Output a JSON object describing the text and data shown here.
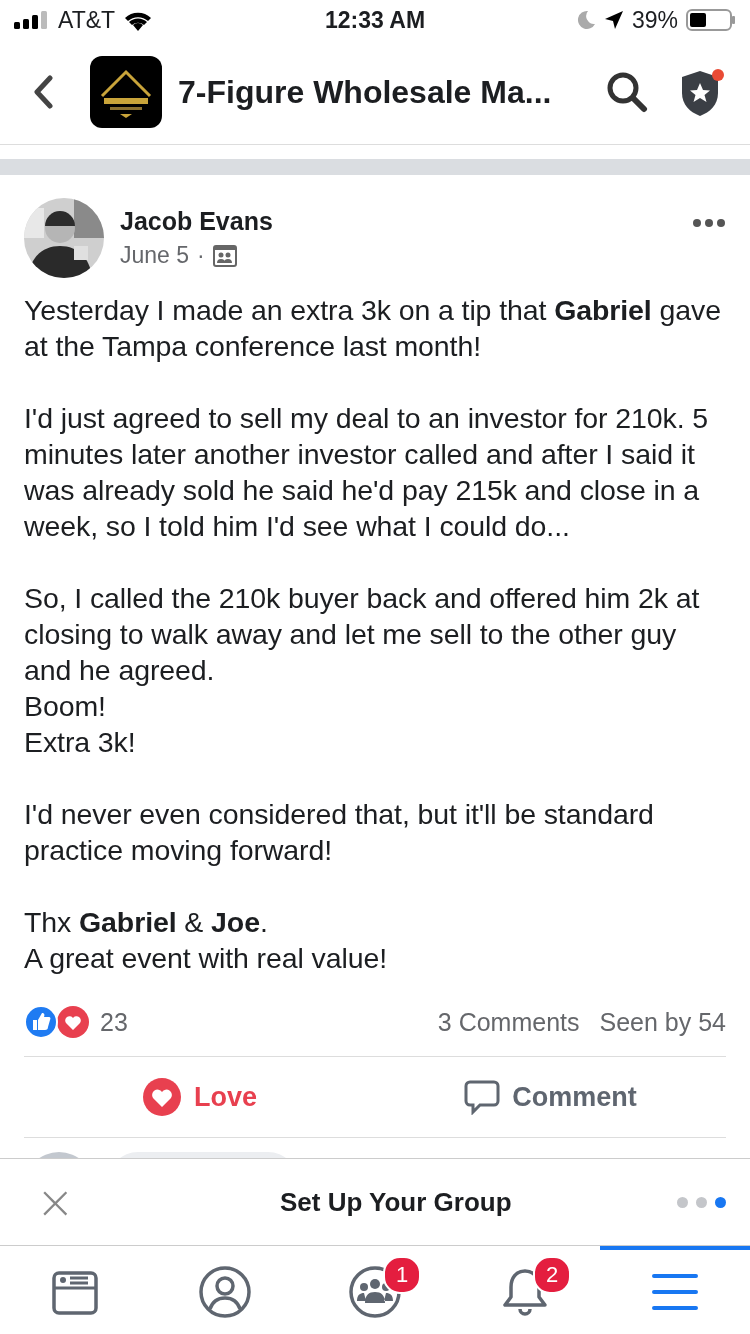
{
  "status_bar": {
    "carrier": "AT&T",
    "time": "12:33 AM",
    "battery": "39%"
  },
  "header": {
    "title": "7-Figure Wholesale Ma...",
    "notification_dot": true
  },
  "post": {
    "author": "Jacob Evans",
    "date": "June 5",
    "separator": "·",
    "paragraphs": [
      [
        "Yesterday I made an extra 3k on a tip that **Gabriel** gave at the Tampa conference last month!"
      ],
      [
        "I'd just agreed to sell my deal to an investor for 210k. 5 minutes later another investor called and after I said it was already sold he said he'd pay 215k and close in a week, so I told him I'd see what I could do..."
      ],
      [
        "So, I called the 210k buyer back and offered him 2k at closing to walk away and let me sell to the other guy and he agreed.",
        "Boom!",
        "Extra 3k!"
      ],
      [
        "I'd never even considered that, but it'll be standard practice moving forward!"
      ],
      [
        "Thx **Gabriel** & **Joe**.",
        "A great event with real value!"
      ]
    ],
    "reaction_count": "23",
    "comments": "3 Comments",
    "seen": "Seen by 54",
    "actions": [
      {
        "kind": "love",
        "label": "Love",
        "selected": true
      },
      {
        "kind": "comment",
        "label": "Comment",
        "selected": false
      }
    ]
  },
  "banner": {
    "title": "Set Up Your Group",
    "close": "×",
    "pages": [
      {
        "selected": false
      },
      {
        "selected": false
      },
      {
        "selected": true
      }
    ]
  },
  "tabs": [
    {
      "kind": "feed",
      "selected": false
    },
    {
      "kind": "profile",
      "selected": false
    },
    {
      "kind": "groups",
      "badge": "1",
      "selected": false
    },
    {
      "kind": "notifications",
      "badge": "2",
      "selected": false
    },
    {
      "kind": "menu",
      "selected": true
    }
  ]
}
